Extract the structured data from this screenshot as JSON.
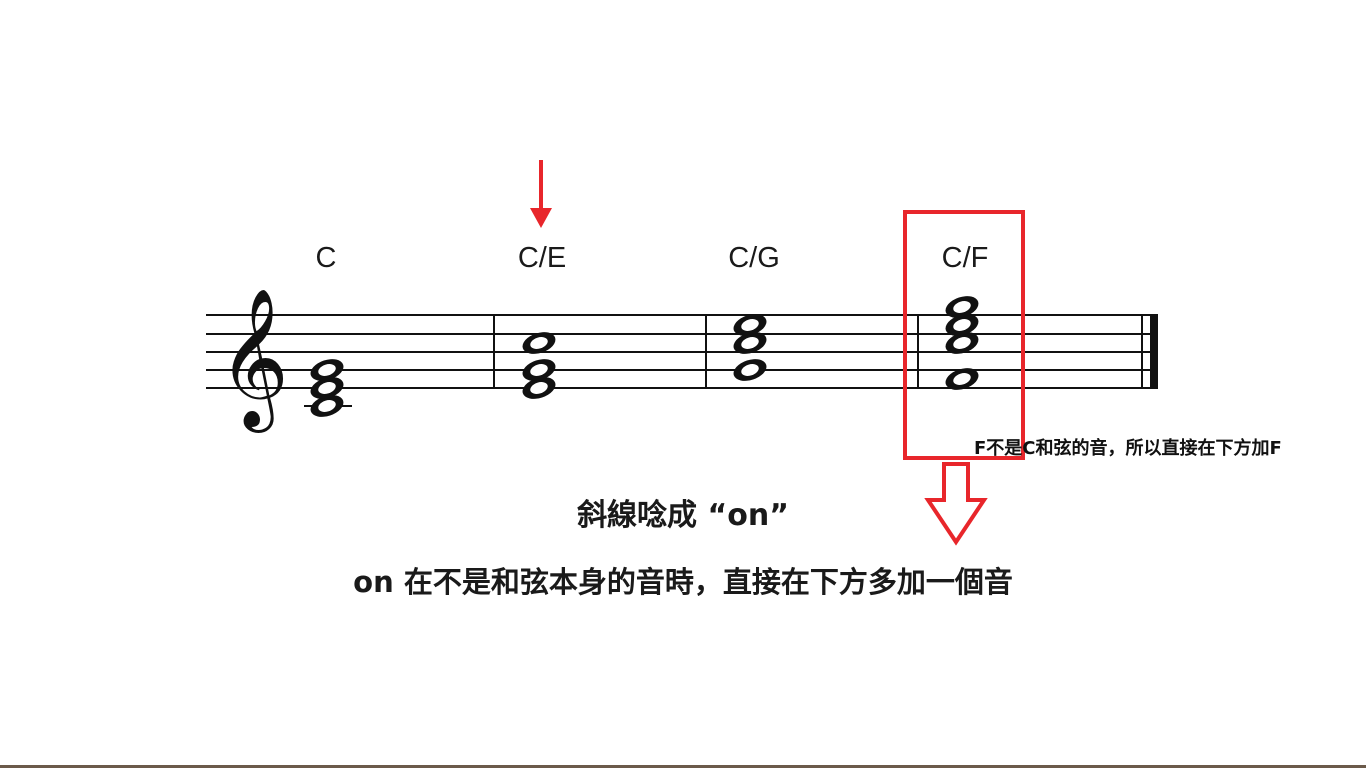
{
  "chords": [
    {
      "label": "C"
    },
    {
      "label": "C/E"
    },
    {
      "label": "C/G"
    },
    {
      "label": "C/F"
    }
  ],
  "captions": {
    "line1": "斜線唸成 “on”",
    "line2": "on 在不是和弦本身的音時，直接在下方多加一個音"
  },
  "annotation": {
    "text": "F不是C和弦的音，所以直接在下方加F"
  },
  "colors": {
    "accent_red": "#e8262b",
    "ink": "#111111"
  },
  "icons": {
    "pointer_arrow": "red-down-arrow-icon",
    "outline_arrow": "outline-down-arrow-icon",
    "clef": "treble-clef-icon"
  }
}
